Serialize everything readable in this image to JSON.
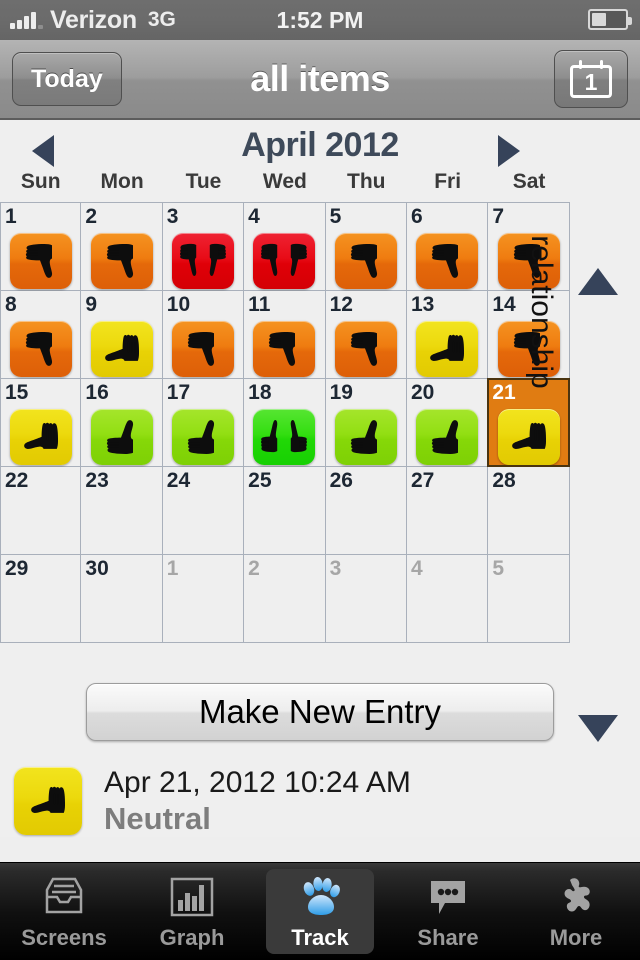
{
  "statusbar": {
    "carrier": "Verizon",
    "network": "3G",
    "time": "1:52 PM",
    "signal_icon": "signal-bars-icon",
    "battery_icon": "battery-icon"
  },
  "navbar": {
    "back_label": "Today",
    "title": "all items",
    "calendar_button_number": "1",
    "calendar_icon": "calendar-icon"
  },
  "calendar": {
    "month_label": "April 2012",
    "prev_icon": "arrow-left-icon",
    "next_icon": "arrow-right-icon",
    "scroll_up_icon": "arrow-up-icon",
    "scroll_down_icon": "arrow-down-icon",
    "category_label": "relationship",
    "daynames": [
      "Sun",
      "Mon",
      "Tue",
      "Wed",
      "Thu",
      "Fri",
      "Sat"
    ],
    "colors": {
      "very_negative": "#e80c17",
      "negative": "#ef7c10",
      "neutral": "#ecd90d",
      "positive": "#92df12",
      "very_positive": "#33de11",
      "selected_cell": "#e07c12"
    },
    "weeks": [
      [
        {
          "day": "1",
          "muted": false,
          "rating": "negative",
          "icon": "thumbs-down-icon"
        },
        {
          "day": "2",
          "muted": false,
          "rating": "negative",
          "icon": "thumbs-down-icon"
        },
        {
          "day": "3",
          "muted": false,
          "rating": "very_negative",
          "icon": "double-thumbs-down-icon"
        },
        {
          "day": "4",
          "muted": false,
          "rating": "very_negative",
          "icon": "double-thumbs-down-icon"
        },
        {
          "day": "5",
          "muted": false,
          "rating": "negative",
          "icon": "thumbs-down-icon"
        },
        {
          "day": "6",
          "muted": false,
          "rating": "negative",
          "icon": "thumbs-down-icon"
        },
        {
          "day": "7",
          "muted": false,
          "rating": "negative",
          "icon": "thumbs-down-icon"
        }
      ],
      [
        {
          "day": "8",
          "muted": false,
          "rating": "negative",
          "icon": "thumbs-down-icon"
        },
        {
          "day": "9",
          "muted": false,
          "rating": "neutral",
          "icon": "flat-hand-icon"
        },
        {
          "day": "10",
          "muted": false,
          "rating": "negative",
          "icon": "thumbs-down-icon"
        },
        {
          "day": "11",
          "muted": false,
          "rating": "negative",
          "icon": "thumbs-down-icon"
        },
        {
          "day": "12",
          "muted": false,
          "rating": "negative",
          "icon": "thumbs-down-icon"
        },
        {
          "day": "13",
          "muted": false,
          "rating": "neutral",
          "icon": "flat-hand-icon"
        },
        {
          "day": "14",
          "muted": false,
          "rating": "negative",
          "icon": "thumbs-down-icon"
        }
      ],
      [
        {
          "day": "15",
          "muted": false,
          "rating": "neutral",
          "icon": "flat-hand-icon"
        },
        {
          "day": "16",
          "muted": false,
          "rating": "positive",
          "icon": "thumbs-up-icon"
        },
        {
          "day": "17",
          "muted": false,
          "rating": "positive",
          "icon": "thumbs-up-icon"
        },
        {
          "day": "18",
          "muted": false,
          "rating": "very_positive",
          "icon": "double-thumbs-up-icon"
        },
        {
          "day": "19",
          "muted": false,
          "rating": "positive",
          "icon": "thumbs-up-icon"
        },
        {
          "day": "20",
          "muted": false,
          "rating": "positive",
          "icon": "thumbs-up-icon"
        },
        {
          "day": "21",
          "muted": false,
          "rating": "neutral",
          "icon": "flat-hand-icon",
          "selected": true
        }
      ],
      [
        {
          "day": "22",
          "muted": false,
          "rating": null,
          "icon": null
        },
        {
          "day": "23",
          "muted": false,
          "rating": null,
          "icon": null
        },
        {
          "day": "24",
          "muted": false,
          "rating": null,
          "icon": null
        },
        {
          "day": "25",
          "muted": false,
          "rating": null,
          "icon": null
        },
        {
          "day": "26",
          "muted": false,
          "rating": null,
          "icon": null
        },
        {
          "day": "27",
          "muted": false,
          "rating": null,
          "icon": null
        },
        {
          "day": "28",
          "muted": false,
          "rating": null,
          "icon": null
        }
      ],
      [
        {
          "day": "29",
          "muted": false,
          "rating": null,
          "icon": null
        },
        {
          "day": "30",
          "muted": false,
          "rating": null,
          "icon": null
        },
        {
          "day": "1",
          "muted": true,
          "rating": null,
          "icon": null
        },
        {
          "day": "2",
          "muted": true,
          "rating": null,
          "icon": null
        },
        {
          "day": "3",
          "muted": true,
          "rating": null,
          "icon": null
        },
        {
          "day": "4",
          "muted": true,
          "rating": null,
          "icon": null
        },
        {
          "day": "5",
          "muted": true,
          "rating": null,
          "icon": null
        }
      ]
    ]
  },
  "entry_section": {
    "new_entry_label": "Make New Entry",
    "entry": {
      "icon": "flat-hand-icon",
      "rating": "neutral",
      "datetime": "Apr 21, 2012 10:24 AM",
      "status": "Neutral"
    }
  },
  "tabbar": {
    "items": [
      {
        "label": "Screens",
        "icon": "inbox-tray-icon",
        "active": false
      },
      {
        "label": "Graph",
        "icon": "bar-chart-icon",
        "active": false
      },
      {
        "label": "Track",
        "icon": "paw-print-icon",
        "active": true
      },
      {
        "label": "Share",
        "icon": "speech-bubble-icon",
        "active": false
      },
      {
        "label": "More",
        "icon": "puzzle-piece-icon",
        "active": false
      }
    ]
  }
}
